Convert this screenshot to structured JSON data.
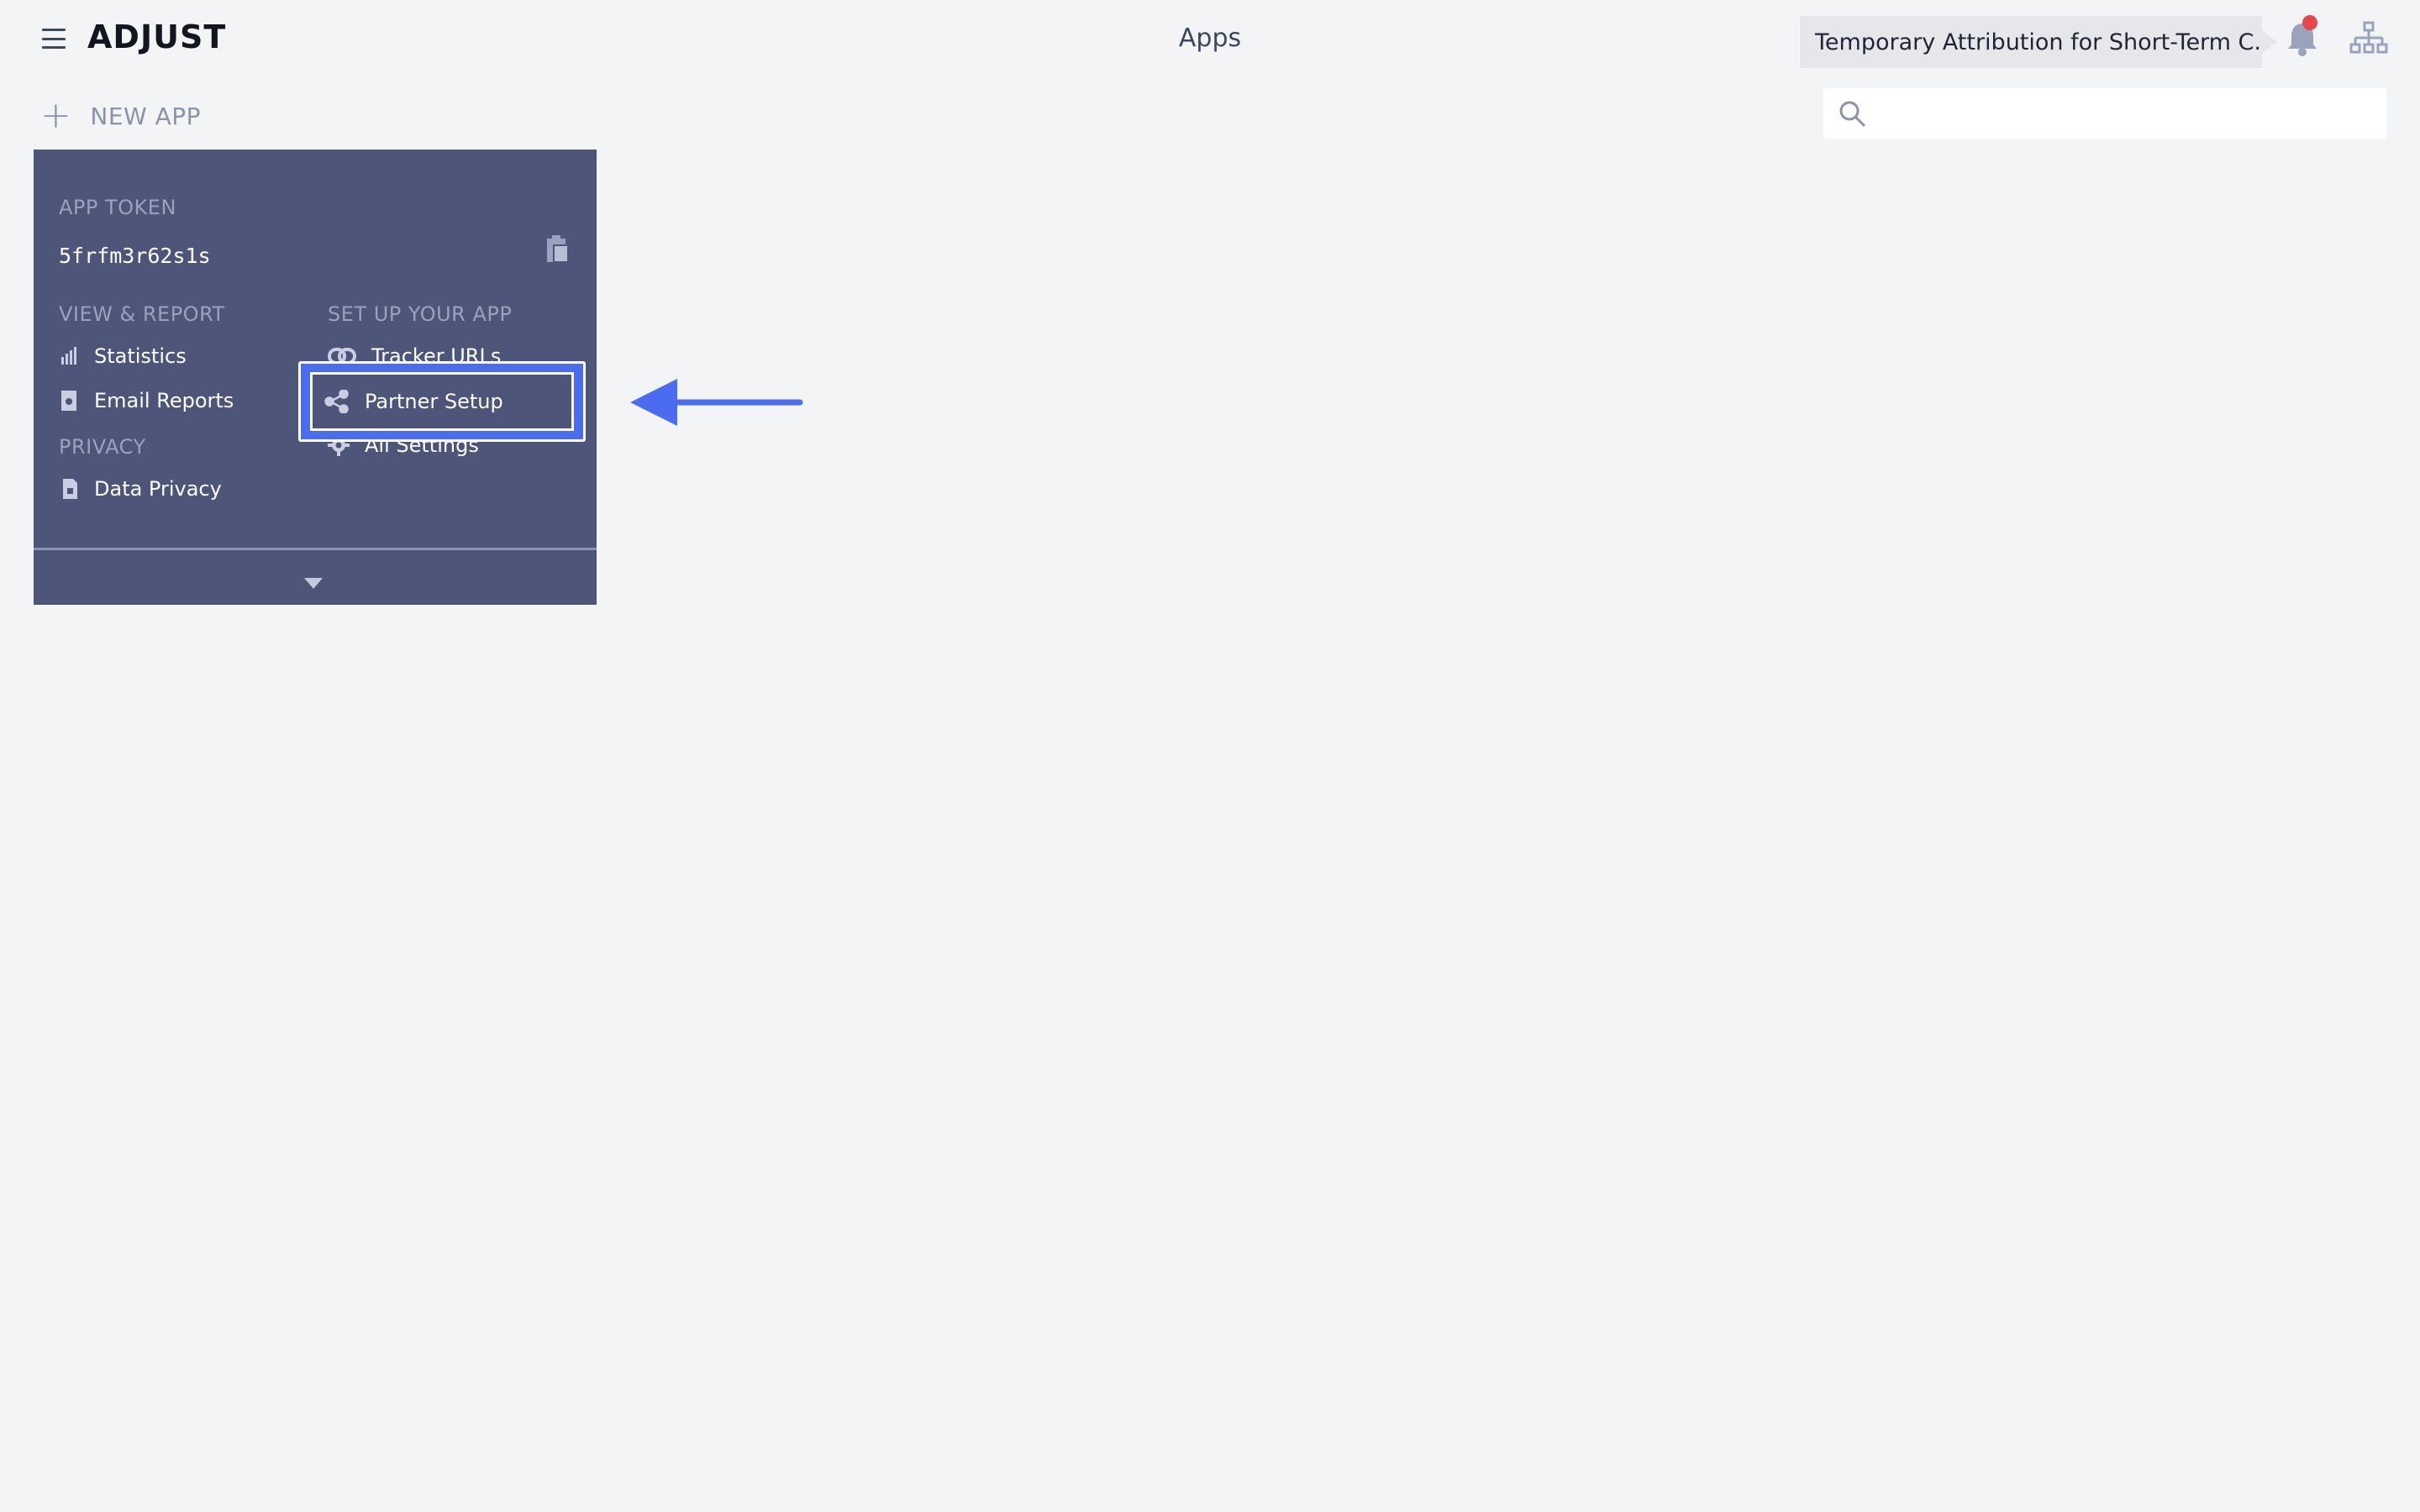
{
  "header": {
    "logo": "ADJUST",
    "page_title": "Apps",
    "notice": "Temporary Attribution for Short-Term C...",
    "menu_icon": "hamburger-icon",
    "bell_icon": "bell-icon",
    "org_icon": "org-chart-icon"
  },
  "toolbar": {
    "new_app_label": "NEW APP",
    "search_placeholder": "",
    "search_value": ""
  },
  "app_card": {
    "token_label": "APP TOKEN",
    "token_value": "5frfm3r62s1s",
    "view_report_label": "VIEW & REPORT",
    "view_report_items": [
      {
        "label": "Statistics",
        "icon": "bar-chart-icon"
      },
      {
        "label": "Email Reports",
        "icon": "email-report-icon"
      }
    ],
    "privacy_label": "PRIVACY",
    "privacy_items": [
      {
        "label": "Data Privacy",
        "icon": "data-privacy-icon"
      }
    ],
    "setup_label": "SET UP YOUR APP",
    "setup_items": [
      {
        "label": "Tracker URLs",
        "icon": "link-icon"
      },
      {
        "label": "Partner Setup",
        "icon": "share-icon"
      },
      {
        "label": "All Settings",
        "icon": "gear-icon"
      }
    ]
  },
  "colors": {
    "background": "#f3f4f6",
    "card": "#4d5578",
    "highlight": "#4a6cf0",
    "notification_dot": "#e5474d"
  }
}
